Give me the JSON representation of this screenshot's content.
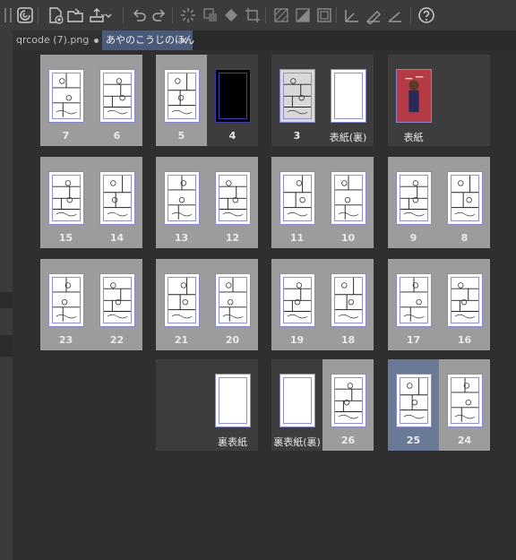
{
  "toolbar": {
    "buttons": [
      "app-logo-icon",
      "new-file-icon",
      "open-folder-icon",
      "export-icon",
      "undo-icon",
      "redo-icon",
      "loading-icon",
      "transform-icon",
      "fill-icon",
      "crop-icon",
      "hatch-icon",
      "gradient-icon",
      "border-icon",
      "ruler-icon",
      "brush-icon",
      "angle-icon",
      "help-icon"
    ]
  },
  "tabs": [
    {
      "label": "qrcode (7).png",
      "modified": true
    },
    {
      "label": "あやのこうじのほん",
      "close": "×",
      "active": true
    }
  ],
  "pages": [
    {
      "label": "7",
      "style": "manga"
    },
    {
      "label": "6",
      "style": "manga"
    },
    {
      "label": "5",
      "style": "manga"
    },
    {
      "label": "4",
      "style": "dark"
    },
    {
      "label": "3",
      "style": "faded"
    },
    {
      "label": "表紙(裏)",
      "style": "blank"
    },
    {
      "label": "表紙",
      "style": "color"
    },
    {
      "label": "15",
      "style": "manga"
    },
    {
      "label": "14",
      "style": "manga"
    },
    {
      "label": "13",
      "style": "manga"
    },
    {
      "label": "12",
      "style": "manga"
    },
    {
      "label": "11",
      "style": "manga"
    },
    {
      "label": "10",
      "style": "manga"
    },
    {
      "label": "9",
      "style": "manga"
    },
    {
      "label": "8",
      "style": "manga"
    },
    {
      "label": "23",
      "style": "manga"
    },
    {
      "label": "22",
      "style": "manga"
    },
    {
      "label": "21",
      "style": "manga"
    },
    {
      "label": "20",
      "style": "manga"
    },
    {
      "label": "19",
      "style": "manga"
    },
    {
      "label": "18",
      "style": "manga"
    },
    {
      "label": "17",
      "style": "manga"
    },
    {
      "label": "16",
      "style": "manga"
    },
    {
      "label": "裏表紙",
      "style": "blank"
    },
    {
      "label": "裏表紙(裏)",
      "style": "blank"
    },
    {
      "label": "26",
      "style": "manga"
    },
    {
      "label": "25",
      "style": "manga",
      "active": true
    },
    {
      "label": "24",
      "style": "manga"
    }
  ]
}
